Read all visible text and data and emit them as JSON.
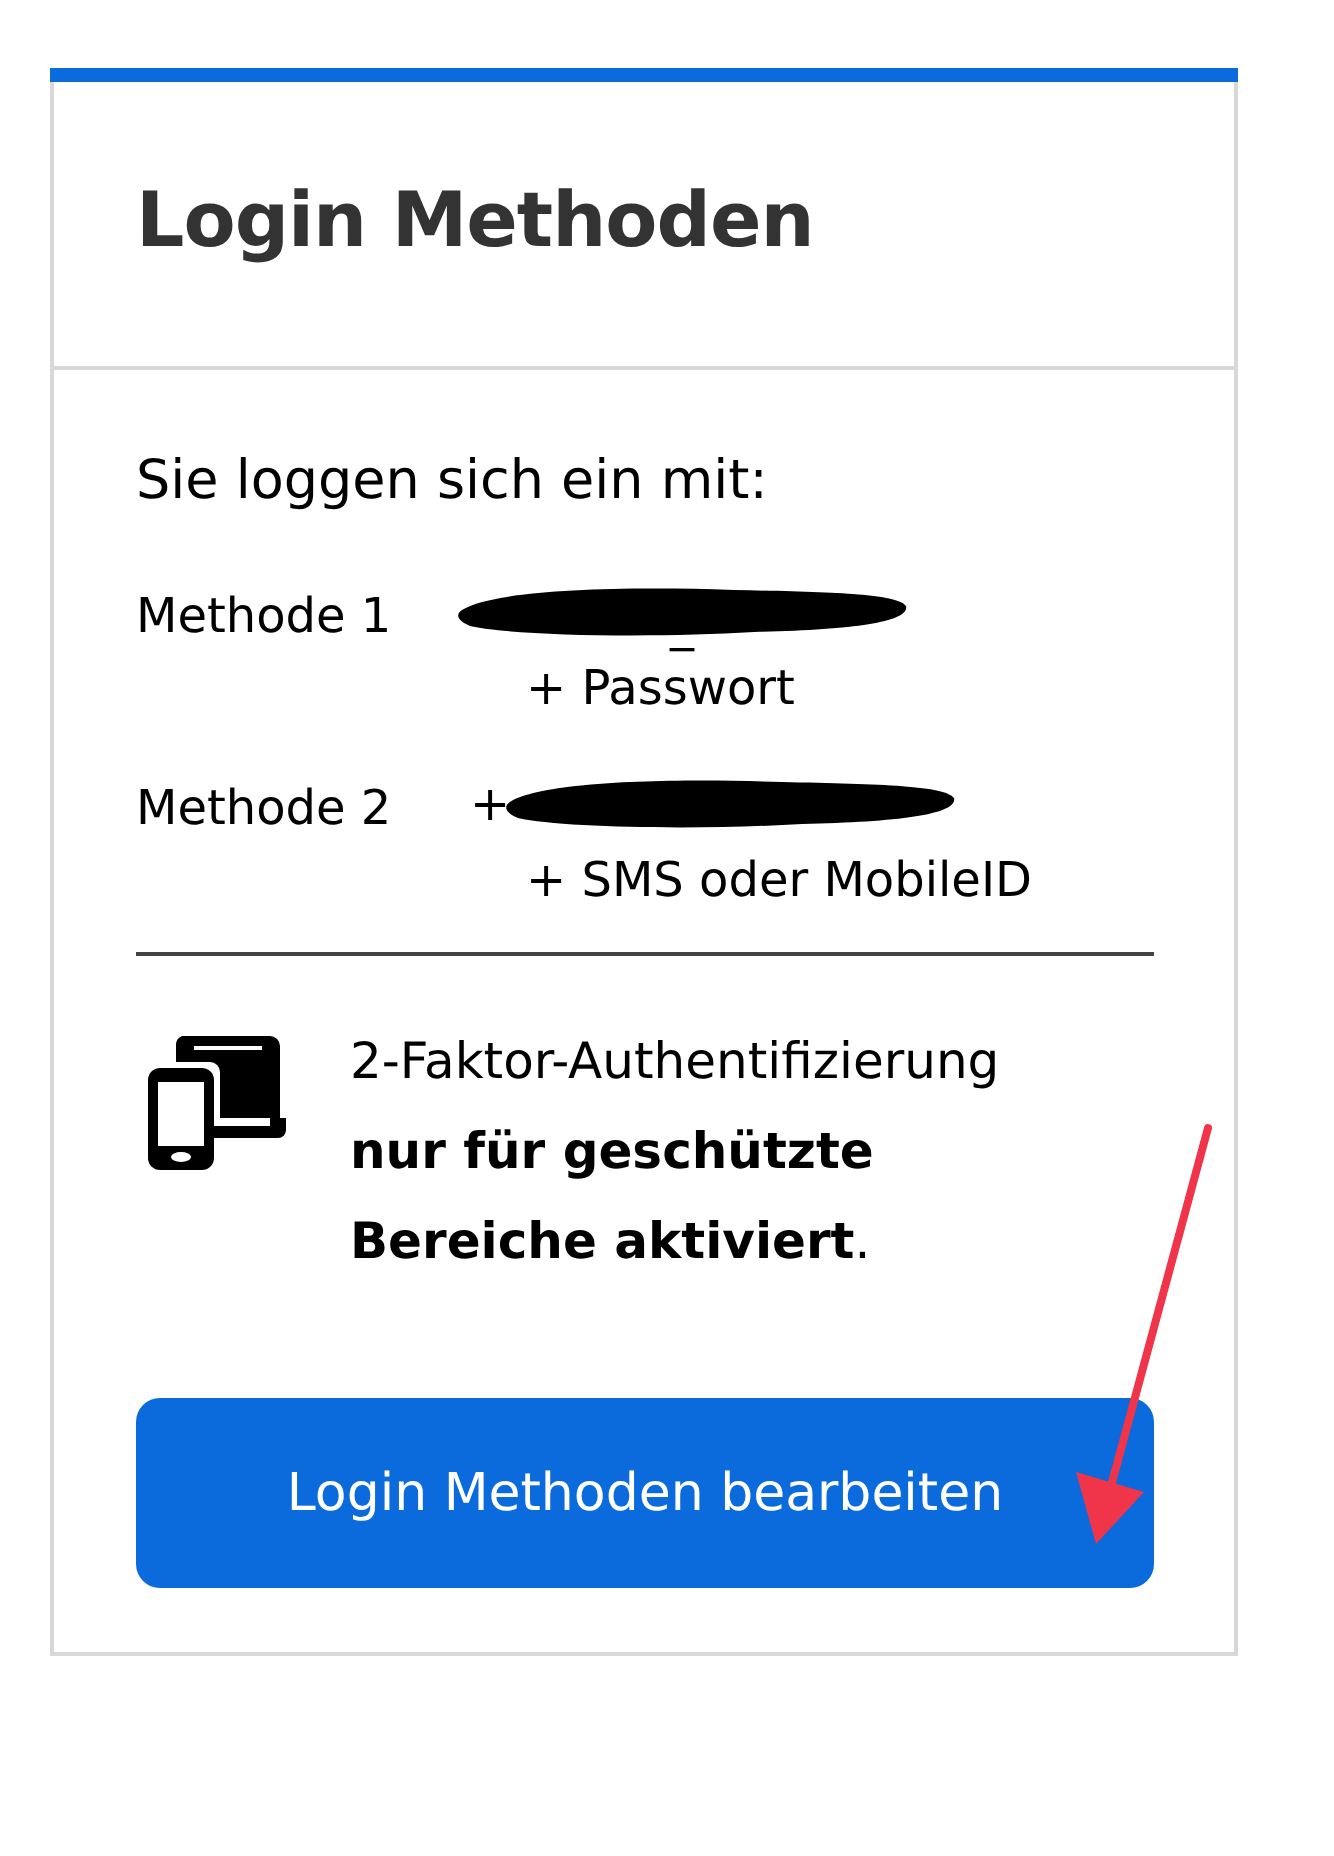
{
  "card": {
    "title": "Login Methoden"
  },
  "intro": "Sie loggen sich ein mit:",
  "methods": [
    {
      "label": "Methode 1",
      "value": "_",
      "redacted": true,
      "detail": "+ Passwort"
    },
    {
      "label": "Methode 2",
      "value": "+",
      "redacted": true,
      "detail": "+ SMS oder MobileID"
    }
  ],
  "two_factor": {
    "text": "2-Faktor-Authentifizierung **nur für geschützte Bereiche aktiviert**."
  },
  "button": "Login Methoden bearbeiten",
  "annotations": [
    {
      "kind": "arrow"
    }
  ]
}
